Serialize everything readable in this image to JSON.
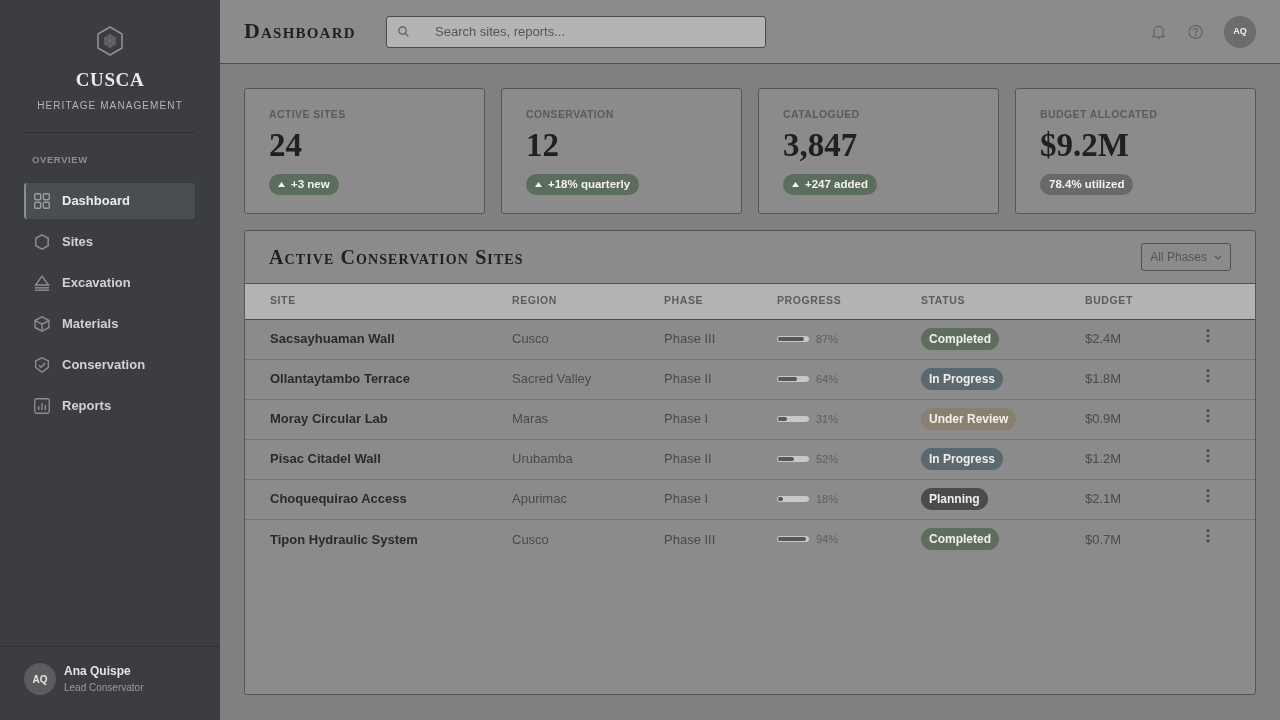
{
  "sidebar": {
    "brand": "CUSCA",
    "tagline": "HERITAGE MANAGEMENT",
    "section": "OVERVIEW",
    "items": [
      {
        "label": "Dashboard",
        "selected": true
      },
      {
        "label": "Sites",
        "selected": false
      },
      {
        "label": "Excavation",
        "selected": false
      },
      {
        "label": "Materials",
        "selected": false
      },
      {
        "label": "Conservation",
        "selected": false
      },
      {
        "label": "Reports",
        "selected": false
      }
    ],
    "user": {
      "initials": "AQ",
      "name": "Ana Quispe",
      "role": "Lead Conservator"
    }
  },
  "header": {
    "title": "Dashboard",
    "search": {
      "placeholder": "Search sites, reports..."
    },
    "avatar": "AQ"
  },
  "stats": [
    {
      "label": "ACTIVE SITES",
      "value": "24",
      "badge": {
        "text": "+3 new",
        "kind": "up"
      }
    },
    {
      "label": "CONSERVATION",
      "value": "12",
      "badge": {
        "text": "+18% quarterly",
        "kind": "up"
      }
    },
    {
      "label": "CATALOGUED",
      "value": "3,847",
      "badge": {
        "text": "+247 added",
        "kind": "up"
      }
    },
    {
      "label": "BUDGET ALLOCATED",
      "value": "$9.2M",
      "badge": {
        "text": "78.4% utilized",
        "kind": "plain"
      }
    }
  ],
  "panel": {
    "title": "Active Conservation Sites",
    "filter": "All Phases",
    "columns": [
      "SITE",
      "REGION",
      "PHASE",
      "PROGRESS",
      "STATUS",
      "BUDGET"
    ],
    "rows": [
      {
        "site": "Sacsayhuaman Wall",
        "region": "Cusco",
        "phase": "Phase III",
        "level": 0.87,
        "reading": "87%",
        "status": {
          "text": "Completed",
          "color": "#5e6e5c"
        },
        "budget": "$2.4M"
      },
      {
        "site": "Ollantaytambo Terrace",
        "region": "Sacred Valley",
        "phase": "Phase II",
        "level": 0.64,
        "reading": "64%",
        "status": {
          "text": "In Progress",
          "color": "#5a6870"
        },
        "budget": "$1.8M"
      },
      {
        "site": "Moray Circular Lab",
        "region": "Maras",
        "phase": "Phase I",
        "level": 0.31,
        "reading": "31%",
        "status": {
          "text": "Under Review",
          "color": "#888070"
        },
        "budget": "$0.9M"
      },
      {
        "site": "Pisac Citadel Wall",
        "region": "Urubamba",
        "phase": "Phase II",
        "level": 0.52,
        "reading": "52%",
        "status": {
          "text": "In Progress",
          "color": "#5a6870"
        },
        "budget": "$1.2M"
      },
      {
        "site": "Choquequirao Access",
        "region": "Apurimac",
        "phase": "Phase I",
        "level": 0.18,
        "reading": "18%",
        "status": {
          "text": "Planning",
          "color": "#4a4b4c"
        },
        "budget": "$2.1M"
      },
      {
        "site": "Tipon Hydraulic System",
        "region": "Cusco",
        "phase": "Phase III",
        "level": 0.94,
        "reading": "94%",
        "status": {
          "text": "Completed",
          "color": "#5e6e5c"
        },
        "budget": "$0.7M"
      }
    ]
  }
}
